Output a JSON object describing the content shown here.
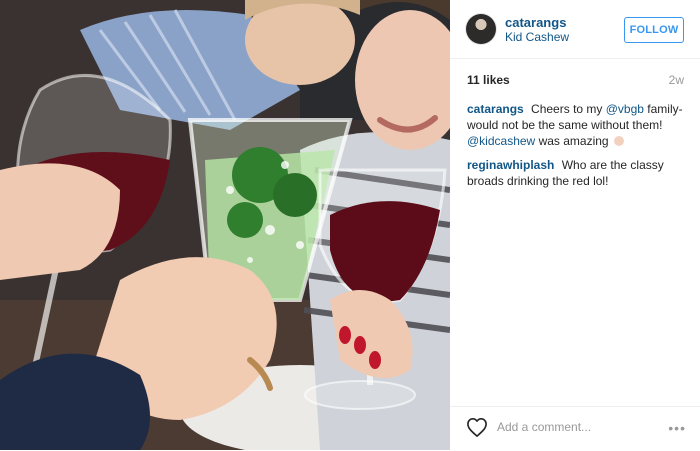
{
  "post": {
    "user": {
      "username": "catarangs",
      "location": "Kid Cashew"
    },
    "follow_label": "FOLLOW",
    "likes": "11 likes",
    "age": "2w",
    "caption": {
      "user": "catarangs",
      "text_1": "Cheers to my",
      "mention_1": "@vbgb",
      "text_2": "family- would not be the same without them!",
      "mention_2": "@kidcashew",
      "text_3": "was amazing"
    },
    "comment": {
      "user": "reginawhiplash",
      "text": "Who are the classy broads drinking the red lol!"
    },
    "add_comment_placeholder": "Add a comment...",
    "more_icon": "•••"
  },
  "icons": {
    "heart": "heart-icon",
    "more": "more-options-icon",
    "emoji": "ok-hand-emoji-icon"
  },
  "colors": {
    "link": "#125688",
    "follow": "#3897f0",
    "muted": "#999999"
  }
}
